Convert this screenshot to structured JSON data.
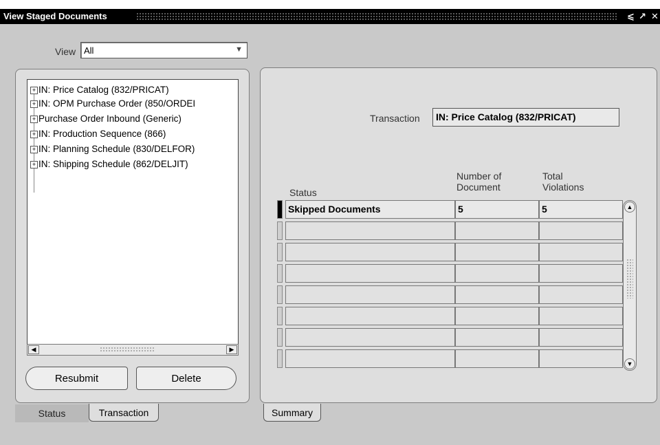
{
  "window": {
    "title": "View Staged Documents",
    "controls": [
      "⩽",
      "↗",
      "✕"
    ]
  },
  "view": {
    "label": "View",
    "selected": "All"
  },
  "tree": {
    "items": [
      "IN: Price Catalog (832/PRICAT)",
      "IN: OPM Purchase Order (850/ORDEI",
      "Purchase Order Inbound (Generic)",
      "IN: Production Sequence (866)",
      "IN: Planning Schedule (830/DELFOR)",
      "IN: Shipping Schedule (862/DELJIT)"
    ]
  },
  "buttons": {
    "resubmit": "Resubmit",
    "delete": "Delete"
  },
  "left_tabs": [
    {
      "label": "Status",
      "active": false
    },
    {
      "label": "Transaction",
      "active": true
    }
  ],
  "right_tabs": [
    {
      "label": "Summary",
      "active": true
    }
  ],
  "summary": {
    "transaction_label": "Transaction",
    "transaction_value": "IN: Price Catalog (832/PRICAT)",
    "columns": {
      "status": "Status",
      "number_of_document_1": "Number of",
      "number_of_document_2": "Document",
      "total_violations_1": "Total",
      "total_violations_2": "Violations"
    },
    "rows": [
      {
        "status": "Skipped Documents",
        "number": "5",
        "violations": "5"
      },
      {
        "status": "",
        "number": "",
        "violations": ""
      },
      {
        "status": "",
        "number": "",
        "violations": ""
      },
      {
        "status": "",
        "number": "",
        "violations": ""
      },
      {
        "status": "",
        "number": "",
        "violations": ""
      },
      {
        "status": "",
        "number": "",
        "violations": ""
      },
      {
        "status": "",
        "number": "",
        "violations": ""
      },
      {
        "status": "",
        "number": "",
        "violations": ""
      }
    ]
  }
}
